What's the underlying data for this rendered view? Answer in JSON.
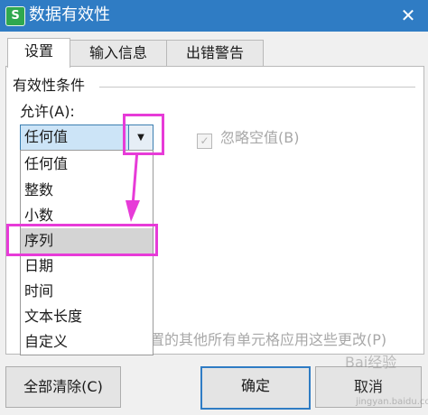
{
  "window": {
    "title": "数据有效性",
    "app_icon_letter": "S"
  },
  "tabs": [
    {
      "label": "设置",
      "active": true
    },
    {
      "label": "输入信息",
      "active": false
    },
    {
      "label": "出错警告",
      "active": false
    }
  ],
  "settings": {
    "group_title": "有效性条件",
    "allow_label": "允许(A):",
    "allow_value": "任何值",
    "options": [
      "任何值",
      "整数",
      "小数",
      "序列",
      "日期",
      "时间",
      "文本长度",
      "自定义"
    ],
    "selected_option": "序列",
    "ignore_blank_label": "忽略空值(B)",
    "ignore_blank_checked": true,
    "apply_changes_text": "置的其他所有单元格应用这些更改(P)"
  },
  "buttons": {
    "clear_all": "全部清除(C)",
    "ok": "确定",
    "cancel": "取消"
  },
  "annotation": {
    "highlight_color": "#e73bd8"
  },
  "watermark": {
    "text": "Bai经验",
    "sub": "jingyan.baidu.com"
  },
  "colors": {
    "titlebar": "#2f7cc4",
    "combo_fill": "#cce4f7",
    "selected_item": "#d4d4d4"
  }
}
